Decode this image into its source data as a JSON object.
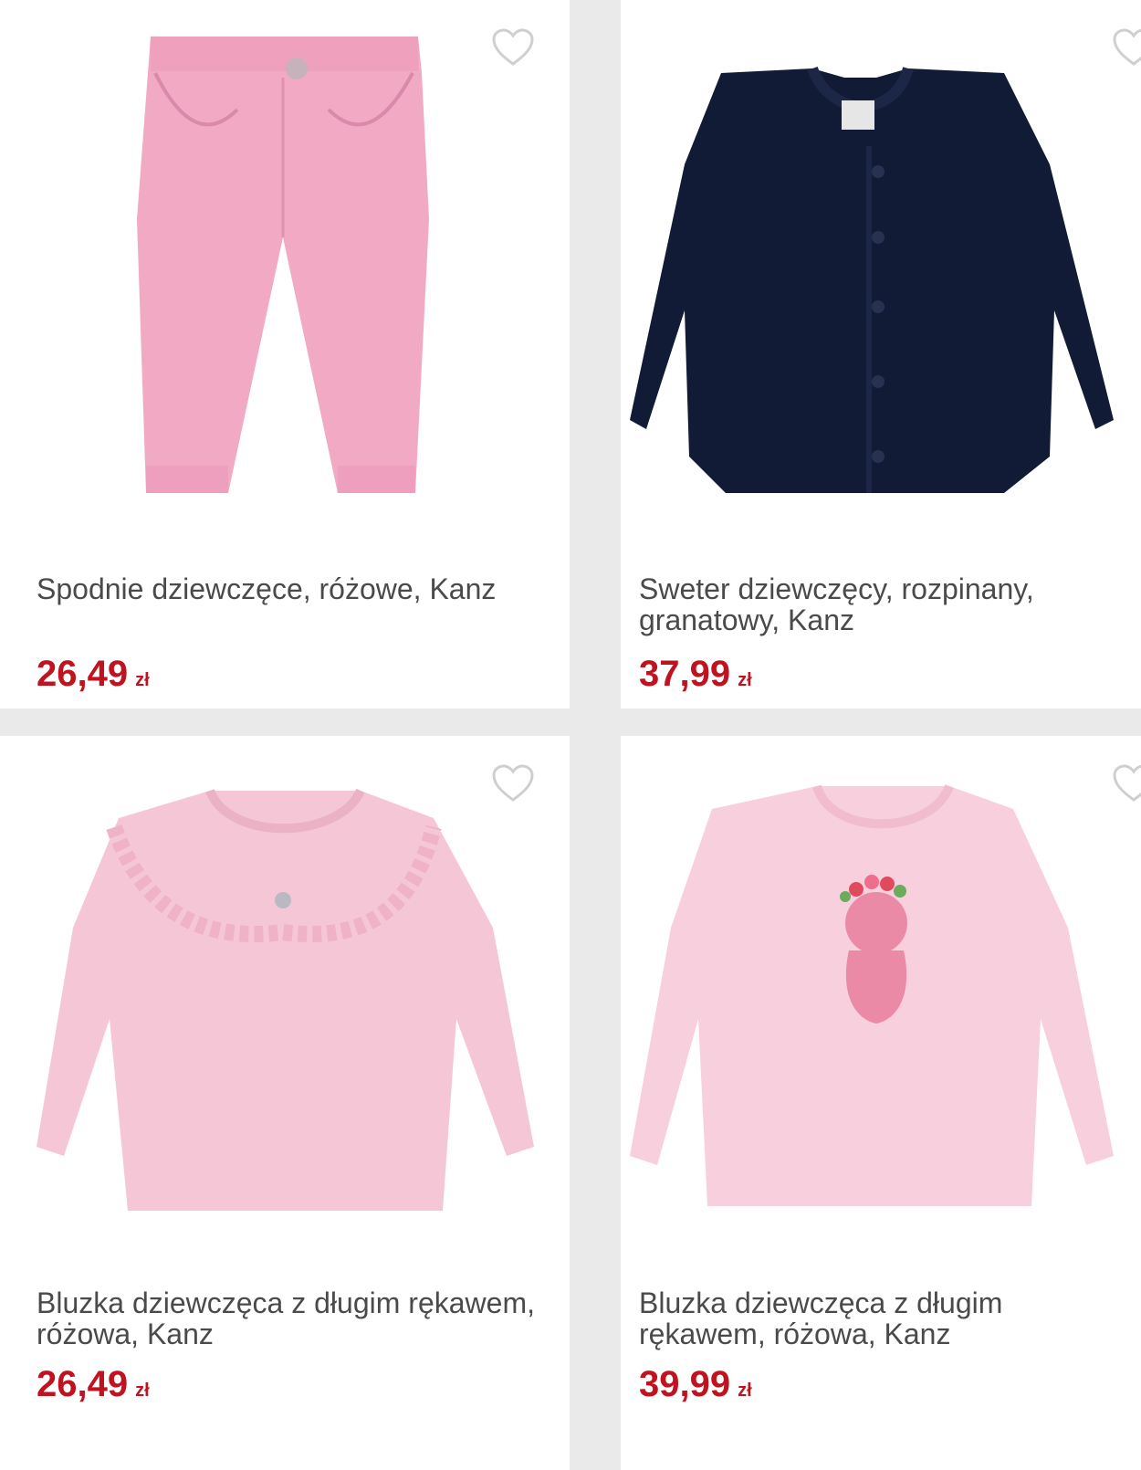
{
  "colors": {
    "price": "#c1121f",
    "name_text": "#4a4a4a",
    "card_bg": "#ffffff",
    "grid_bg": "#eaeaea",
    "heart_outline": "#cfcfcf"
  },
  "icons": {
    "favorite": "heart-outline-icon"
  },
  "products": [
    {
      "name": "Spodnie dziewczęce, różowe, Kanz",
      "price": "26,49",
      "currency": "zł"
    },
    {
      "name": "Sweter dziewczęcy, rozpinany, granatowy, Kanz",
      "price": "37,99",
      "currency": "zł"
    },
    {
      "name": "Bluzka dziewczęca z długim rękawem, różowa, Kanz",
      "price": "26,49",
      "currency": "zł"
    },
    {
      "name": "Bluzka dziewczęca z długim rękawem, różowa, Kanz",
      "price": "39,99",
      "currency": "zł"
    }
  ]
}
